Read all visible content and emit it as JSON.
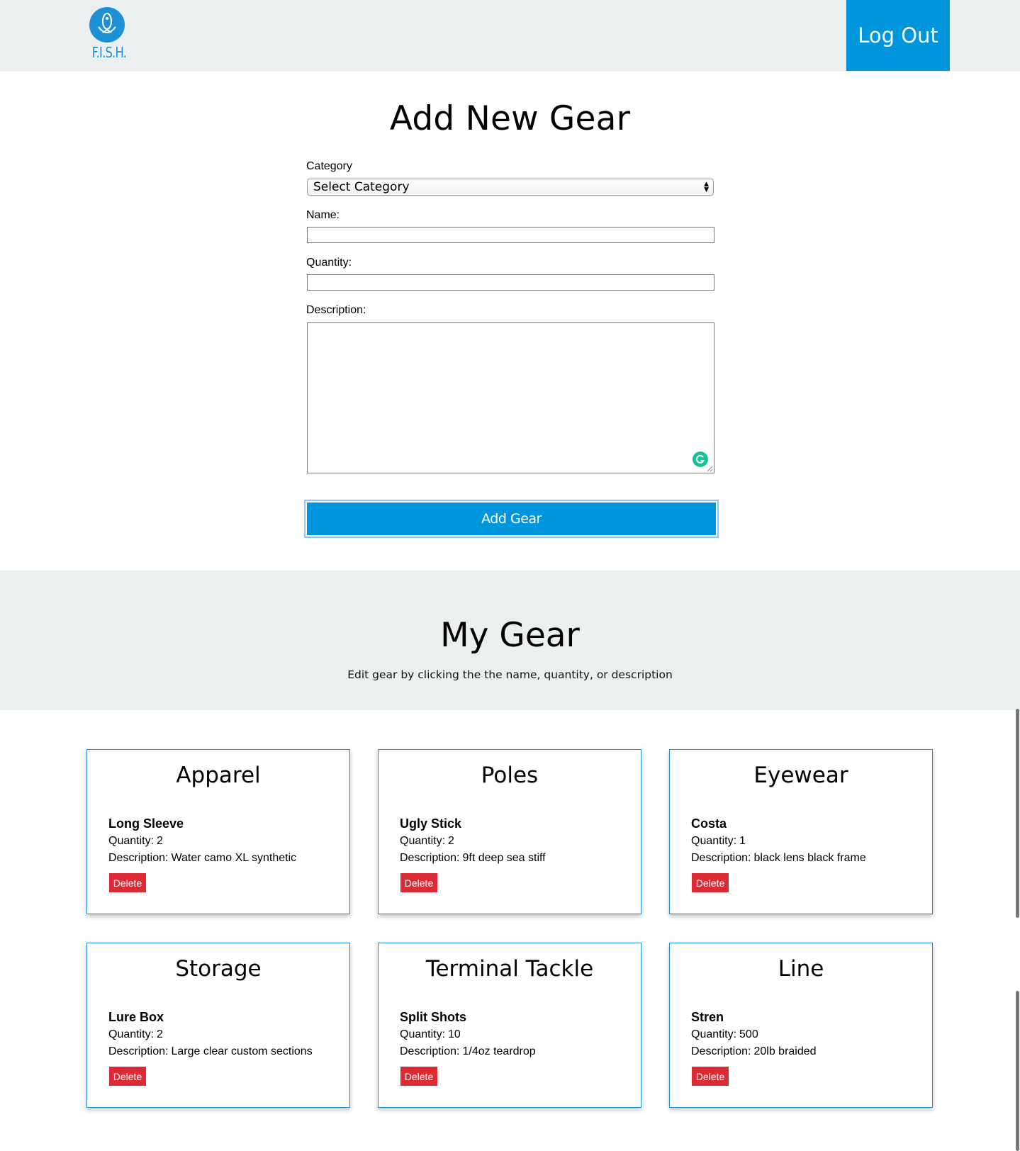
{
  "header": {
    "logo_text": "F.I.S.H.",
    "logout_label": "Log Out"
  },
  "form": {
    "title": "Add New Gear",
    "category_label": "Category",
    "category_selected": "Select Category",
    "name_label": "Name:",
    "name_value": "",
    "quantity_label": "Quantity:",
    "quantity_value": "",
    "description_label": "Description:",
    "description_value": "",
    "submit_label": "Add Gear"
  },
  "my_gear": {
    "title": "My Gear",
    "hint": "Edit gear by clicking the the name, quantity, or description"
  },
  "cards": [
    {
      "category": "Apparel",
      "name": "Long Sleeve",
      "quantity_label": "Quantity:",
      "quantity": "2",
      "description_label": "Description:",
      "description": "Water camo XL synthetic",
      "delete_label": "Delete"
    },
    {
      "category": "Poles",
      "name": "Ugly Stick",
      "quantity_label": "Quantity:",
      "quantity": "2",
      "description_label": "Description:",
      "description": "9ft deep sea stiff",
      "delete_label": "Delete"
    },
    {
      "category": "Eyewear",
      "name": "Costa",
      "quantity_label": "Quantity:",
      "quantity": "1",
      "description_label": "Description:",
      "description": "black lens black frame",
      "delete_label": "Delete"
    },
    {
      "category": "Storage",
      "name": "Lure Box",
      "quantity_label": "Quantity:",
      "quantity": "2",
      "description_label": "Description:",
      "description": "Large clear custom sections",
      "delete_label": "Delete"
    },
    {
      "category": "Terminal Tackle",
      "name": "Split Shots",
      "quantity_label": "Quantity:",
      "quantity": "10",
      "description_label": "Description:",
      "description": "1/4oz teardrop",
      "delete_label": "Delete"
    },
    {
      "category": "Line",
      "name": "Stren",
      "quantity_label": "Quantity:",
      "quantity": "500",
      "description_label": "Description:",
      "description": "20lb braided",
      "delete_label": "Delete"
    }
  ],
  "colors": {
    "brand_blue": "#0096dd",
    "delete_red": "#dc2b34",
    "band_gray": "#eceff0"
  },
  "icons": [
    "fish-logo-icon",
    "grammarly-icon",
    "select-arrows-icon",
    "resize-handle-icon"
  ]
}
